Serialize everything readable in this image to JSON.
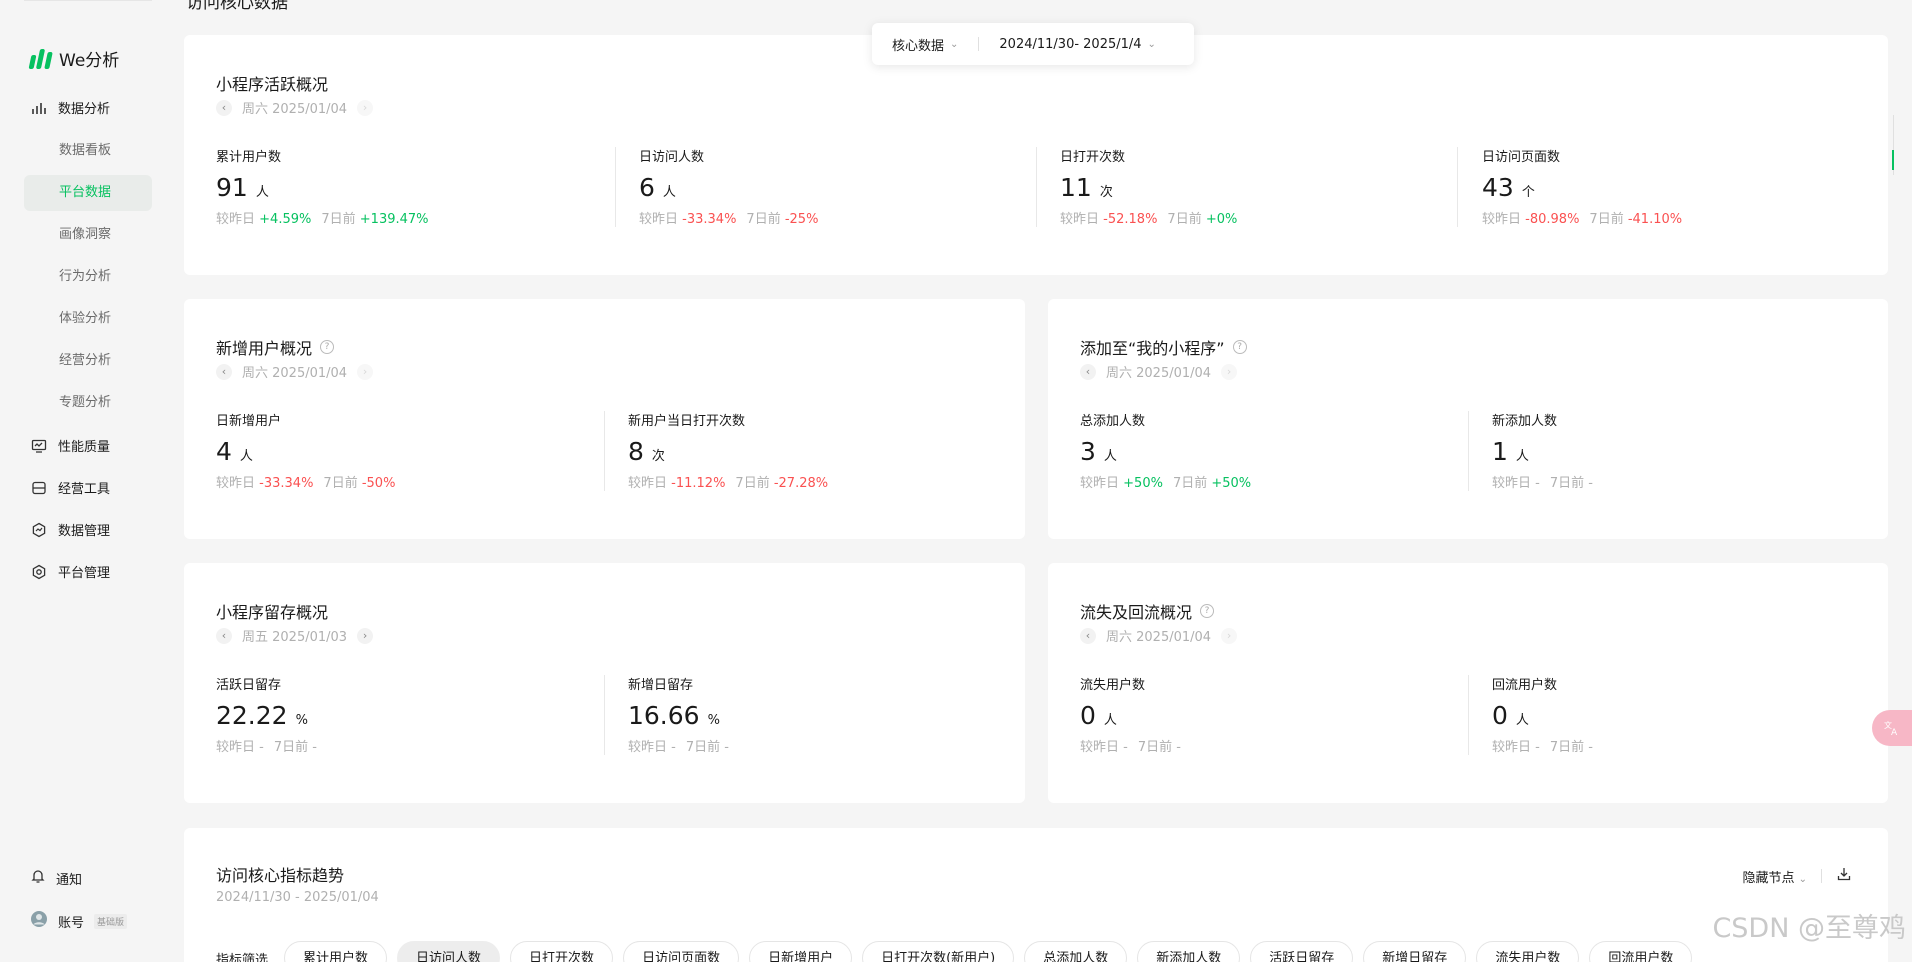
{
  "app": {
    "logo_text": "We分析"
  },
  "page_heading": "访问核心数据",
  "sidebar": {
    "groups": [
      {
        "label": "数据分析",
        "icon": "bar-chart-icon"
      },
      {
        "label": "性能质量",
        "icon": "monitor-icon"
      },
      {
        "label": "经营工具",
        "icon": "box-icon"
      },
      {
        "label": "数据管理",
        "icon": "hexagon-chart-icon"
      },
      {
        "label": "平台管理",
        "icon": "gear-icon"
      }
    ],
    "sub_items": [
      {
        "label": "数据看板"
      },
      {
        "label": "平台数据"
      },
      {
        "label": "画像洞察"
      },
      {
        "label": "行为分析"
      },
      {
        "label": "体验分析"
      },
      {
        "label": "经营分析"
      },
      {
        "label": "专题分析"
      }
    ],
    "active_sub": "平台数据",
    "bottom": {
      "notify": "通知",
      "account": "账号",
      "account_badge": "基础版"
    }
  },
  "filter_bar": {
    "data_select": "核心数据",
    "date_range": "2024/11/30- 2025/1/4"
  },
  "cards": {
    "active": {
      "title": "小程序活跃概况",
      "date": "周六 2025/01/04",
      "metrics": [
        {
          "label": "累计用户数",
          "value": "91",
          "unit": "人",
          "day_label": "较昨日",
          "day": "+4.59%",
          "week_label": "7日前",
          "week": "+139.47%"
        },
        {
          "label": "日访问人数",
          "value": "6",
          "unit": "人",
          "day_label": "较昨日",
          "day": "-33.34%",
          "week_label": "7日前",
          "week": "-25%"
        },
        {
          "label": "日打开次数",
          "value": "11",
          "unit": "次",
          "day_label": "较昨日",
          "day": "-52.18%",
          "week_label": "7日前",
          "week": "+0%"
        },
        {
          "label": "日访问页面数",
          "value": "43",
          "unit": "个",
          "day_label": "较昨日",
          "day": "-80.98%",
          "week_label": "7日前",
          "week": "-41.10%"
        }
      ]
    },
    "new_users": {
      "title": "新增用户概况",
      "date": "周六 2025/01/04",
      "metrics": [
        {
          "label": "日新增用户",
          "value": "4",
          "unit": "人",
          "day_label": "较昨日",
          "day": "-33.34%",
          "week_label": "7日前",
          "week": "-50%"
        },
        {
          "label": "新用户当日打开次数",
          "value": "8",
          "unit": "次",
          "day_label": "较昨日",
          "day": "-11.12%",
          "week_label": "7日前",
          "week": "-27.28%"
        }
      ]
    },
    "added": {
      "title": "添加至“我的小程序”",
      "date": "周六 2025/01/04",
      "metrics": [
        {
          "label": "总添加人数",
          "value": "3",
          "unit": "人",
          "day_label": "较昨日",
          "day": "+50%",
          "week_label": "7日前",
          "week": "+50%"
        },
        {
          "label": "新添加人数",
          "value": "1",
          "unit": "人",
          "day_label": "较昨日",
          "day": "-",
          "week_label": "7日前",
          "week": "-"
        }
      ]
    },
    "retention": {
      "title": "小程序留存概况",
      "date": "周五 2025/01/03",
      "metrics": [
        {
          "label": "活跃日留存",
          "value": "22.22",
          "unit": "%",
          "day_label": "较昨日",
          "day": "-",
          "week_label": "7日前",
          "week": "-"
        },
        {
          "label": "新增日留存",
          "value": "16.66",
          "unit": "%",
          "day_label": "较昨日",
          "day": "-",
          "week_label": "7日前",
          "week": "-"
        }
      ]
    },
    "churn": {
      "title": "流失及回流概况",
      "date": "周六 2025/01/04",
      "metrics": [
        {
          "label": "流失用户数",
          "value": "0",
          "unit": "人",
          "day_label": "较昨日",
          "day": "-",
          "week_label": "7日前",
          "week": "-"
        },
        {
          "label": "回流用户数",
          "value": "0",
          "unit": "人",
          "day_label": "较昨日",
          "day": "-",
          "week_label": "7日前",
          "week": "-"
        }
      ]
    },
    "trend": {
      "title": "访问核心指标趋势",
      "date_range": "2024/11/30 - 2025/01/04",
      "hide_nodes": "隐藏节点",
      "filter_label": "指标筛选",
      "chips": [
        "累计用户数",
        "日访问人数",
        "日打开次数",
        "日访问页面数",
        "日新增用户",
        "日打开次数(新用户)",
        "总添加人数",
        "新添加人数",
        "活跃日留存",
        "新增日留存",
        "流失用户数",
        "回流用户数"
      ],
      "active_chip": "日访问人数"
    }
  },
  "watermark": "CSDN @至尊鸡",
  "colors": {
    "accent": "#07c160",
    "down": "#fa5151"
  }
}
